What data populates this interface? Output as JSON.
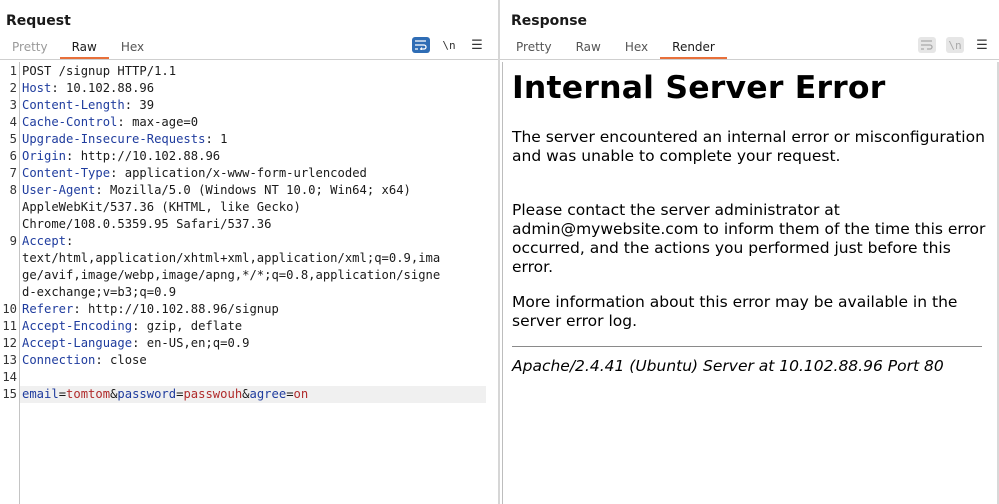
{
  "request": {
    "title": "Request",
    "tabs": [
      {
        "label": "Pretty"
      },
      {
        "label": "Raw"
      },
      {
        "label": "Hex"
      }
    ],
    "active_tab": "Raw",
    "toolbar": {
      "newline_label": "\\n"
    },
    "lines": [
      {
        "n": "1",
        "text": "POST /signup HTTP/1.1"
      },
      {
        "n": "2",
        "key": "Host",
        "val": ": 10.102.88.96"
      },
      {
        "n": "3",
        "key": "Content-Length",
        "val": ": 39"
      },
      {
        "n": "4",
        "key": "Cache-Control",
        "val": ": max-age=0"
      },
      {
        "n": "5",
        "key": "Upgrade-Insecure-Requests",
        "val": ": 1"
      },
      {
        "n": "6",
        "key": "Origin",
        "val": ": http://10.102.88.96"
      },
      {
        "n": "7",
        "key": "Content-Type",
        "val": ": application/x-www-form-urlencoded"
      },
      {
        "n": "8",
        "key": "User-Agent",
        "val": ": Mozilla/5.0 (Windows NT 10.0; Win64; x64)"
      },
      {
        "n": "",
        "text": "AppleWebKit/537.36 (KHTML, like Gecko)"
      },
      {
        "n": "",
        "text": "Chrome/108.0.5359.95 Safari/537.36"
      },
      {
        "n": "9",
        "key": "Accept",
        "val": ":"
      },
      {
        "n": "",
        "text": "text/html,application/xhtml+xml,application/xml;q=0.9,ima"
      },
      {
        "n": "",
        "text": "ge/avif,image/webp,image/apng,*/*;q=0.8,application/signe"
      },
      {
        "n": "",
        "text": "d-exchange;v=b3;q=0.9"
      },
      {
        "n": "10",
        "key": "Referer",
        "val": ": http://10.102.88.96/signup"
      },
      {
        "n": "11",
        "key": "Accept-Encoding",
        "val": ": gzip, deflate"
      },
      {
        "n": "12",
        "key": "Accept-Language",
        "val": ": en-US,en;q=0.9"
      },
      {
        "n": "13",
        "key": "Connection",
        "val": ": close"
      },
      {
        "n": "14",
        "text": ""
      }
    ],
    "body_line": {
      "n": "15",
      "p1_name": "email",
      "eq1": "=",
      "p1_val": "tomtom",
      "amp1": "&",
      "p2_name": "password",
      "eq2": "=",
      "p2_val": "passwouh",
      "amp2": "&",
      "p3_name": "agree",
      "eq3": "=",
      "p3_val": "on"
    }
  },
  "response": {
    "title": "Response",
    "tabs": [
      {
        "label": "Pretty"
      },
      {
        "label": "Raw"
      },
      {
        "label": "Hex"
      },
      {
        "label": "Render"
      }
    ],
    "active_tab": "Render",
    "toolbar": {
      "newline_label": "\\n"
    },
    "render": {
      "heading": "Internal Server Error",
      "para1": "The server encountered an internal error or misconfiguration and was unable to complete your request.",
      "para2": "Please contact the server administrator at admin@mywebsite.com to inform them of the time this error occurred, and the actions you performed just before this error.",
      "para3": "More information about this error may be available in the server error log.",
      "address": "Apache/2.4.41 (Ubuntu) Server at 10.102.88.96 Port 80"
    }
  },
  "colors": {
    "accent": "#e8703a",
    "active_button": "#2f6db5",
    "header_key": "#1f3c9e",
    "param_value": "#b02b2b"
  },
  "icons": [
    "layout-side-by-side-icon",
    "layout-stacked-icon",
    "layout-single-icon",
    "word-wrap-icon",
    "newline-icon",
    "menu-icon"
  ]
}
